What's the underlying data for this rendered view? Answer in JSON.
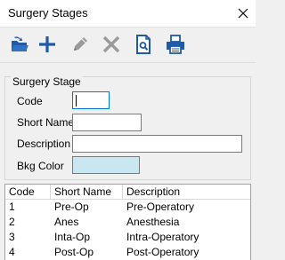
{
  "window": {
    "title": "Surgery Stages"
  },
  "toolbar": [
    {
      "name": "open-button",
      "icon": "open-folder-icon"
    },
    {
      "name": "add-button",
      "icon": "plus-icon"
    },
    {
      "name": "edit-button",
      "icon": "pencil-icon"
    },
    {
      "name": "delete-button",
      "icon": "x-icon"
    },
    {
      "name": "preview-button",
      "icon": "page-search-icon"
    },
    {
      "name": "print-button",
      "icon": "printer-icon"
    }
  ],
  "form": {
    "group_title": "Surgery Stage",
    "code_label": "Code",
    "code_value": "",
    "short_name_label": "Short Name",
    "short_name_value": "",
    "description_label": "Description",
    "description_value": "",
    "bkg_color_label": "Bkg Color",
    "bkg_color_value": "#c8e7f0"
  },
  "table": {
    "headers": [
      "Code",
      "Short Name",
      "Description"
    ],
    "rows": [
      {
        "code": "1",
        "short_name": "Pre-Op",
        "description": "Pre-Operatory"
      },
      {
        "code": "2",
        "short_name": "Anes",
        "description": "Anesthesia"
      },
      {
        "code": "3",
        "short_name": "Inta-Op",
        "description": "Intra-Operatory"
      },
      {
        "code": "4",
        "short_name": "Post-Op",
        "description": "Post-Operatory"
      }
    ]
  },
  "colors": {
    "accent": "#0078d7",
    "toolbar_icon_active": "#1e5aa8",
    "toolbar_icon_disabled": "#9a9a9a"
  }
}
